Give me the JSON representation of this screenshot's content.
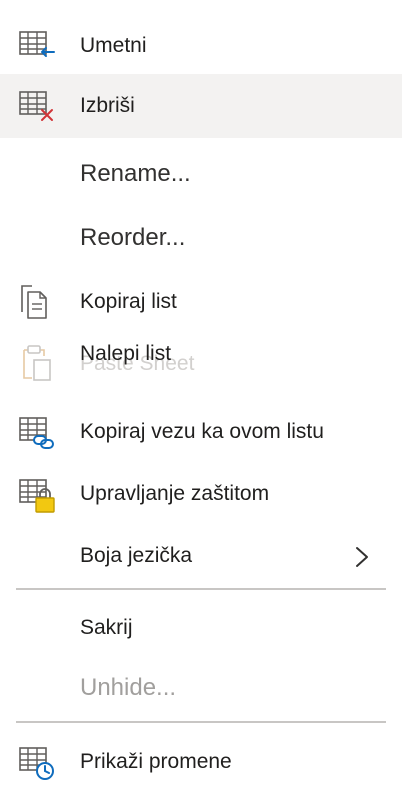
{
  "menu": {
    "items": [
      {
        "label": "Umetni",
        "icon": "insert-sheet-icon"
      },
      {
        "label": "Izbriši",
        "icon": "delete-sheet-icon"
      },
      {
        "label": "Rename...",
        "icon": ""
      },
      {
        "label": "Reorder...",
        "icon": ""
      },
      {
        "label": "Kopiraj list",
        "icon": "copy-sheet-icon"
      },
      {
        "label": "Nalepi list",
        "icon": "paste-sheet-icon"
      },
      {
        "label": "Kopiraj vezu ka ovom listu",
        "icon": "link-sheet-icon"
      },
      {
        "label": "Upravljanje zaštitom",
        "icon": "protect-sheet-icon"
      },
      {
        "label": "Boja jezička",
        "icon": "chevron-right-icon"
      },
      {
        "label": "Sakrij",
        "icon": ""
      },
      {
        "label": "Unhide...",
        "icon": "",
        "disabled": true
      },
      {
        "label": "Prikaži promene",
        "icon": "show-changes-icon"
      }
    ],
    "ghost_text": "Paste Sheet"
  },
  "colors": {
    "accent": "#0f6cbd",
    "delete": "#d13438",
    "lock": "#c19c00",
    "grid": "#605e5c",
    "hover_bg": "#f3f2f1"
  }
}
